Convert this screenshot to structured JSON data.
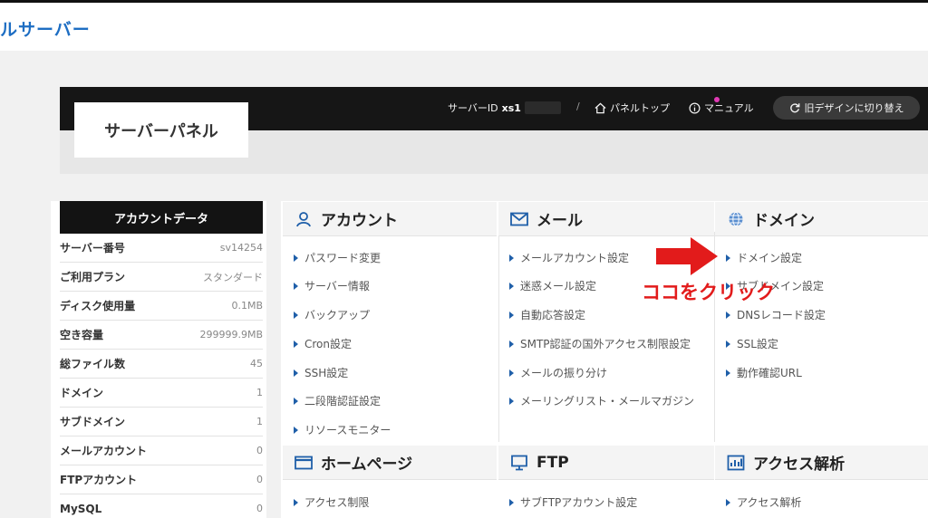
{
  "brand": "ルサーバー",
  "header": {
    "panel_title": "サーバーパネル",
    "server_id_label": "サーバーID",
    "server_id_value": "xs1",
    "separator": "/",
    "panel_top": "パネルトップ",
    "manual": "マニュアル",
    "old_design_button": "旧デザインに切り替え"
  },
  "account": {
    "title": "アカウントデータ",
    "rows": [
      {
        "label": "サーバー番号",
        "value": "sv14254"
      },
      {
        "label": "ご利用プラン",
        "value": "スタンダード"
      },
      {
        "label": "ディスク使用量",
        "value": "0.1MB"
      },
      {
        "label": "空き容量",
        "value": "299999.9MB"
      },
      {
        "label": "総ファイル数",
        "value": "45"
      },
      {
        "label": "ドメイン",
        "value": "1"
      },
      {
        "label": "サブドメイン",
        "value": "1"
      },
      {
        "label": "メールアカウント",
        "value": "0"
      },
      {
        "label": "FTPアカウント",
        "value": "0"
      },
      {
        "label": "MySQL",
        "value": "0"
      }
    ]
  },
  "sections": {
    "account": {
      "title": "アカウント",
      "icon": "user-icon",
      "items": [
        "パスワード変更",
        "サーバー情報",
        "バックアップ",
        "Cron設定",
        "SSH設定",
        "二段階認証設定",
        "リソースモニター"
      ]
    },
    "mail": {
      "title": "メール",
      "icon": "mail-icon",
      "items": [
        "メールアカウント設定",
        "迷惑メール設定",
        "自動応答設定",
        "SMTP認証の国外アクセス制限設定",
        "メールの振り分け",
        "メーリングリスト・メールマガジン"
      ]
    },
    "domain": {
      "title": "ドメイン",
      "icon": "globe-icon",
      "items": [
        "ドメイン設定",
        "サブドメイン設定",
        "DNSレコード設定",
        "SSL設定",
        "動作確認URL"
      ]
    },
    "homepage": {
      "title": "ホームページ",
      "icon": "window-icon",
      "items": [
        "アクセス制限"
      ]
    },
    "ftp": {
      "title": "FTP",
      "icon": "monitor-icon",
      "items": [
        "サブFTPアカウント設定"
      ]
    },
    "analytics": {
      "title": "アクセス解析",
      "icon": "chart-icon",
      "items": [
        "アクセス解析"
      ]
    }
  },
  "annotation": {
    "text": "ココをクリック",
    "color": "#e21b1b"
  },
  "colors": {
    "brand": "#1e6ec3",
    "accent": "#1f5fa9",
    "header_bg": "#161616"
  }
}
